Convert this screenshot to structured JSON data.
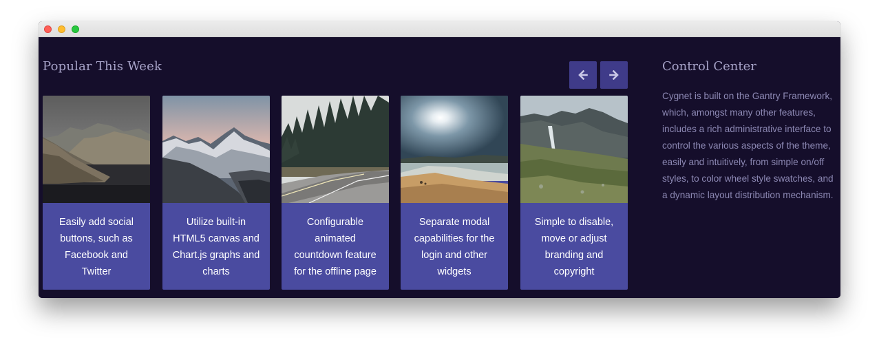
{
  "window": {
    "colors": {
      "background": "#150e2b",
      "accent": "#3f3b89",
      "card": "#4a4ba0"
    }
  },
  "popular": {
    "title": "Popular This Week",
    "prev_icon": "arrow-left-icon",
    "next_icon": "arrow-right-icon",
    "cards": [
      {
        "image": "coastal-mountains-photo",
        "caption": "Easily add social buttons, such as Facebook and Twitter"
      },
      {
        "image": "snowy-mountains-photo",
        "caption": "Utilize built-in HTML5 canvas and Chart.js graphs and charts"
      },
      {
        "image": "forest-road-photo",
        "caption": "Configurable animated countdown feature for the offline page"
      },
      {
        "image": "sunny-beach-photo",
        "caption": "Separate modal capabilities for the login and other widgets"
      },
      {
        "image": "misty-cliffs-photo",
        "caption": "Simple to disable, move or adjust branding and copyright"
      }
    ]
  },
  "control_center": {
    "title": "Control Center",
    "body": "Cygnet is built on the Gantry Framework, which, amongst many other features, includes a rich administrative interface to control the various aspects of the theme, easily and intuitively, from simple on/off styles, to color wheel style swatches, and a dynamic layout distribution mechanism."
  }
}
